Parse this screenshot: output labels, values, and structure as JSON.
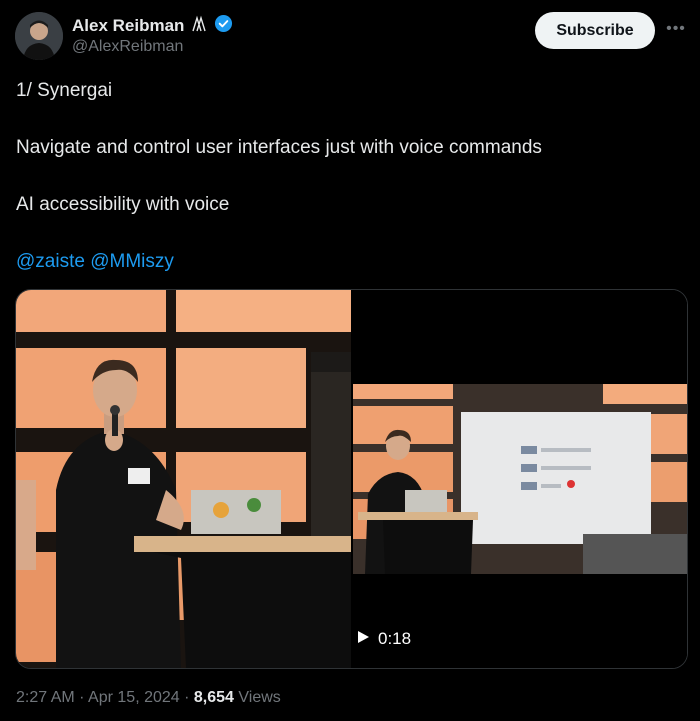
{
  "author": {
    "name": "Alex Reibman",
    "handle": "@AlexReibman"
  },
  "subscribe_label": "Subscribe",
  "tweet": {
    "line1": "1/ Synergai",
    "line2": "Navigate and control user interfaces just with voice commands",
    "line3": "AI accessibility with voice",
    "mentions": [
      "@zaiste",
      "@MMiszy"
    ]
  },
  "video": {
    "duration": "0:18"
  },
  "meta": {
    "time": "2:27 AM",
    "date": "Apr 15, 2024",
    "views_count": "8,654",
    "views_label": "Views"
  },
  "colors": {
    "background": "#000000",
    "accent": "#1d9bf0",
    "verified": "#1d9bf0",
    "muted": "#71767b"
  }
}
